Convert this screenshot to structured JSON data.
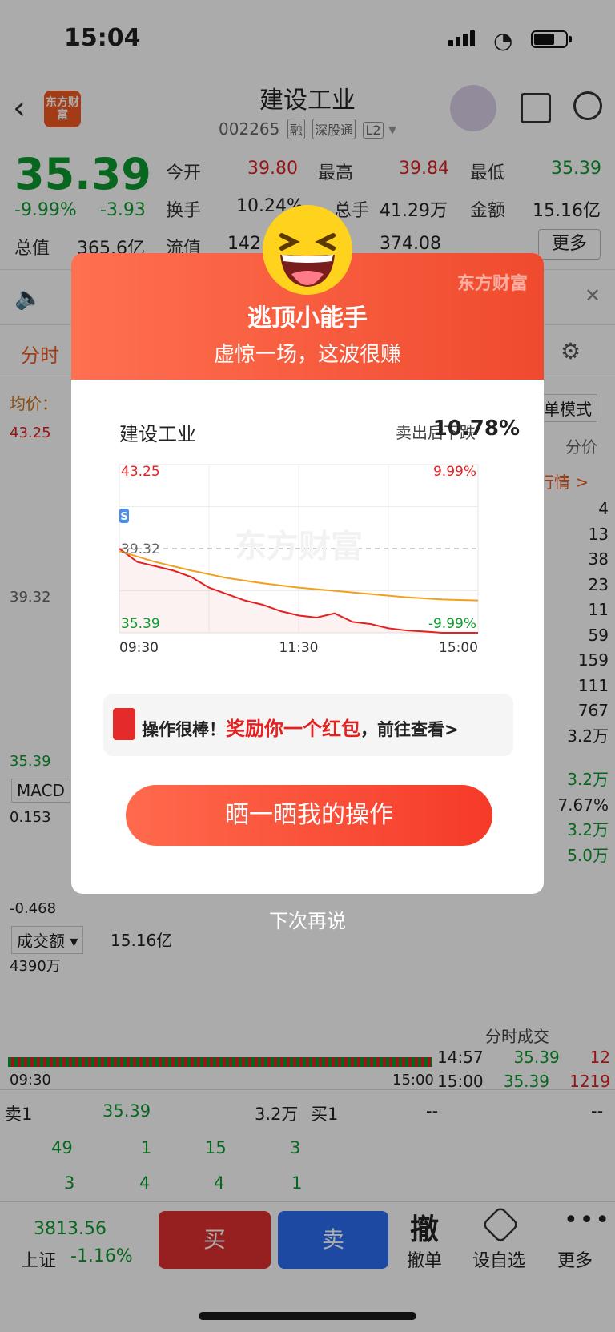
{
  "status_bar": {
    "time": "15:04"
  },
  "header": {
    "title": "建设工业",
    "code": "002265",
    "tags": [
      "融",
      "深股通",
      "L2"
    ],
    "logo_text": "东方财富"
  },
  "quote": {
    "price": "35.39",
    "change_pct": "-9.99%",
    "change": "-3.93",
    "open_label": "今开",
    "open": "39.80",
    "high_label": "最高",
    "high": "39.84",
    "low_label": "最低",
    "low": "35.39",
    "turnover_label": "换手",
    "turnover": "10.24%",
    "volume_label": "总手",
    "volume": "41.29万",
    "amount_label": "金额",
    "amount": "15.16亿",
    "mcap_label": "总值",
    "mcap": "365.6亿",
    "float_label": "流值",
    "float": "142",
    "more_label": "更多",
    "extra": "374.08"
  },
  "tabs": {
    "first": "分时",
    "avg": "均价："
  },
  "bg_chart": {
    "top_price": "43.25",
    "mid_price": "39.32",
    "low_price": "35.39",
    "macd_label": "MACD",
    "macd_val": "0.153",
    "macd_low": "-0.468",
    "amount_label": "成交额",
    "amount_val": "15.16亿",
    "vol_max": "4390万",
    "time_start": "09:30",
    "time_end": "15:00"
  },
  "right_col": {
    "mode": "单模式",
    "col_head": "分价",
    "link": "行情 >",
    "nums": [
      "4",
      "13",
      "38",
      "23",
      "11",
      "59",
      "159",
      "111",
      "767",
      "3.2万"
    ],
    "stats": [
      "3.2万",
      "7.67%",
      "3.2万",
      "5.0万"
    ],
    "trades_title": "分时成交",
    "trades": [
      {
        "time": "14:57",
        "price": "35.39",
        "vol": "12"
      },
      {
        "time": "15:00",
        "price": "35.39",
        "vol": "1219"
      }
    ]
  },
  "order_book": {
    "sell1_label": "卖1",
    "sell1_price": "35.39",
    "sell1_vol": "3.2万",
    "buy1_label": "买1",
    "buy1_price": "--",
    "buy1_vol": "--",
    "row1": [
      "49",
      "1",
      "15",
      "3"
    ],
    "row2": [
      "3",
      "4",
      "4",
      "1"
    ]
  },
  "bottom_bar": {
    "index_value": "3813.56",
    "index_name": "上证",
    "index_change": "-1.16%",
    "buy": "买",
    "sell": "卖",
    "cancel_icon": "撤",
    "cancel": "撤单",
    "watchlist": "设自选",
    "more": "更多"
  },
  "modal": {
    "brand": "东方财富",
    "title": "逃顶小能手",
    "subtitle": "虚惊一场，这波很赚",
    "stock_name": "建设工业",
    "drop_label": "卖出后下跌",
    "drop_value": "10.78%",
    "banner_a": "操作很棒！",
    "banner_b": "奖励你一个红包",
    "banner_c": "，前往查看>",
    "share_button": "晒一晒我的操作",
    "later": "下次再说"
  },
  "chart_data": {
    "type": "line",
    "title": "",
    "watermark": "东方财富",
    "x_ticks": [
      "09:30",
      "11:30",
      "15:00"
    ],
    "y_left_ticks": [
      "43.25",
      "39.32",
      "35.39"
    ],
    "y_right_ticks": [
      "9.99%",
      "-9.99%"
    ],
    "ylim": [
      35.39,
      43.25
    ],
    "marker": "S",
    "series": [
      {
        "color": "#e52020",
        "x": [
          0,
          5,
          10,
          15,
          20,
          25,
          30,
          35,
          40,
          45,
          50,
          55,
          60,
          65,
          70,
          75,
          80,
          85,
          90,
          100
        ],
        "y": [
          39.32,
          38.7,
          38.5,
          38.3,
          38.0,
          37.5,
          37.2,
          36.9,
          36.7,
          36.4,
          36.2,
          36.1,
          36.3,
          35.9,
          35.8,
          35.6,
          35.5,
          35.45,
          35.39,
          35.39
        ]
      },
      {
        "color": "#f0a020",
        "x": [
          0,
          10,
          20,
          30,
          40,
          50,
          60,
          70,
          80,
          90,
          100
        ],
        "y": [
          39.2,
          38.7,
          38.3,
          37.95,
          37.7,
          37.5,
          37.35,
          37.2,
          37.05,
          36.95,
          36.9
        ]
      }
    ]
  }
}
